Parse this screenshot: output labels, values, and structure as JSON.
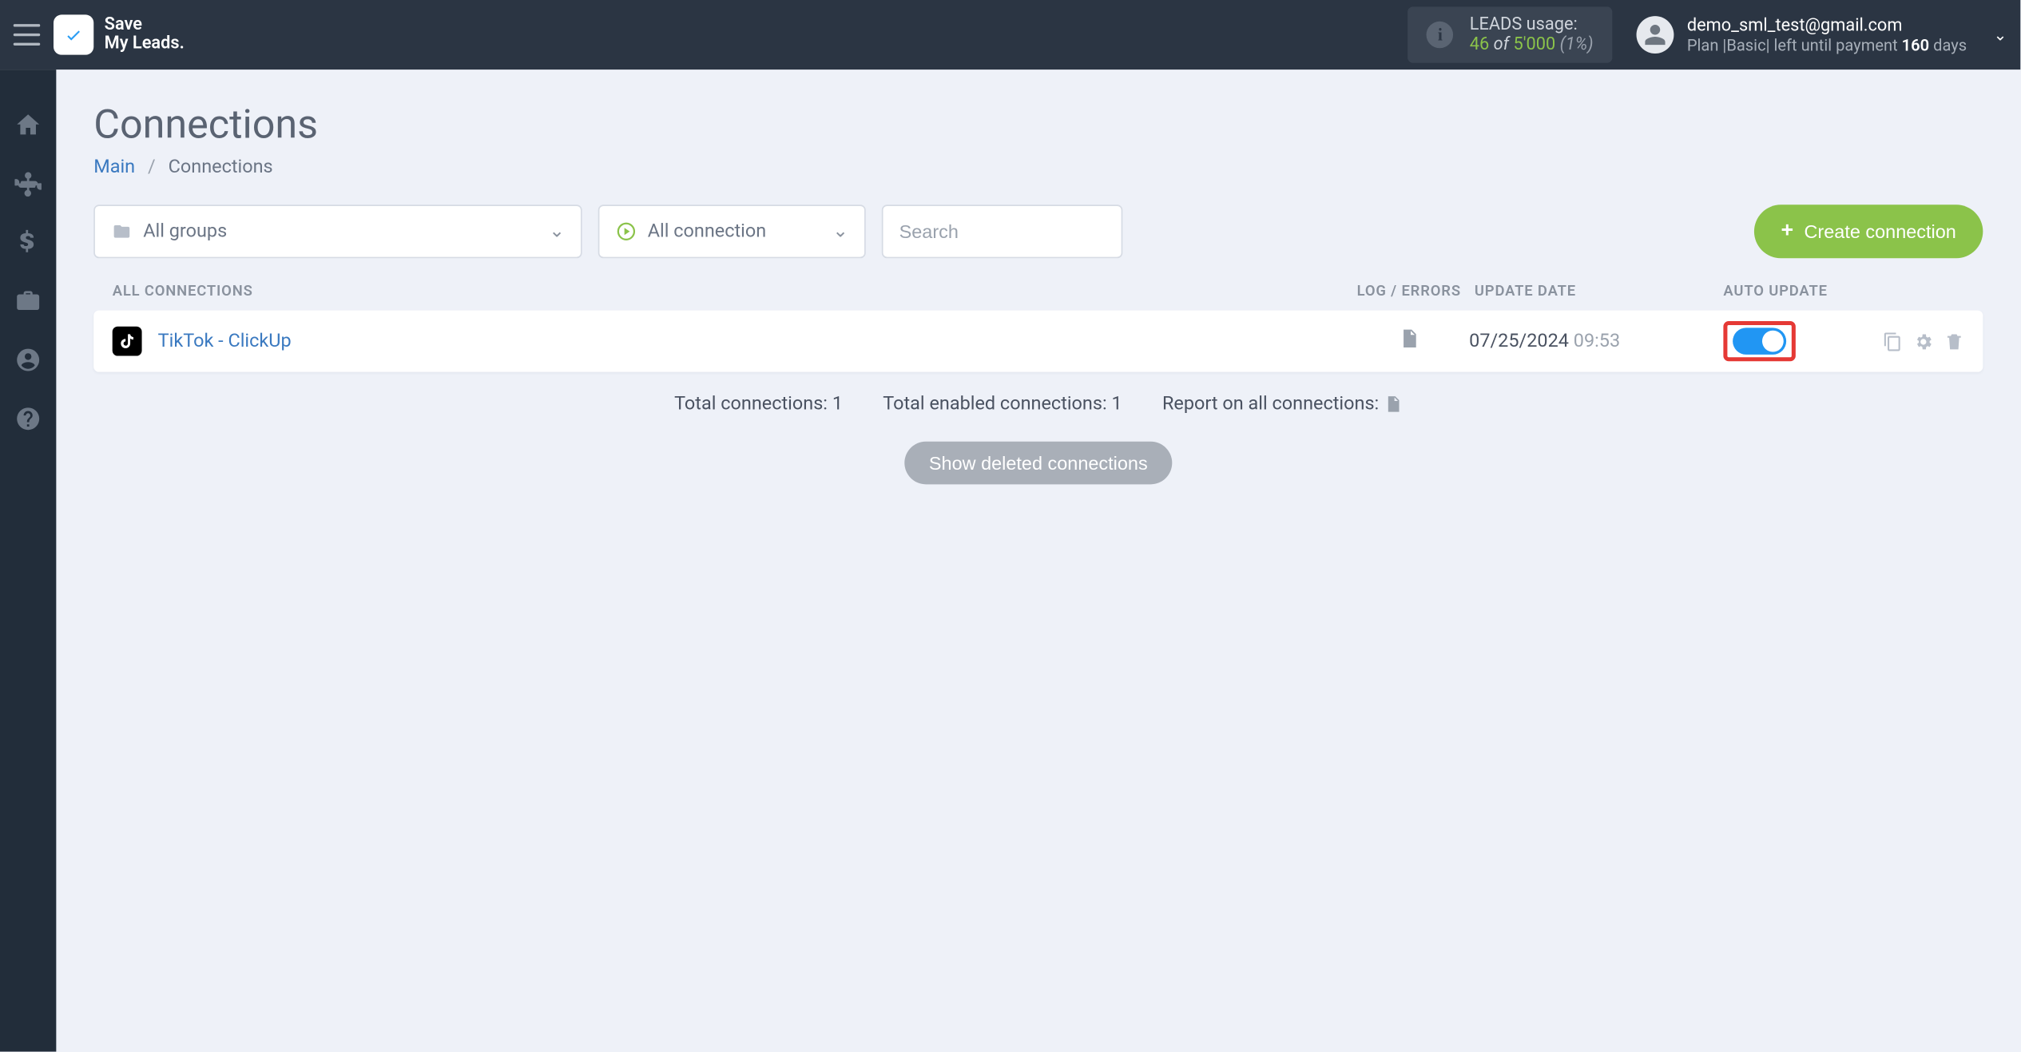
{
  "header": {
    "brand_line1": "Save",
    "brand_line2": "My Leads.",
    "leads_usage_label": "LEADS usage:",
    "leads_used": "46",
    "leads_of": "of",
    "leads_total": "5'000",
    "leads_pct": "(1%)",
    "user_email": "demo_sml_test@gmail.com",
    "plan_prefix": "Plan |",
    "plan_name": "Basic",
    "plan_mid": "| left until payment",
    "plan_days": "160",
    "plan_suffix": "days"
  },
  "page": {
    "title": "Connections",
    "breadcrumb_main": "Main",
    "breadcrumb_current": "Connections"
  },
  "filters": {
    "groups_label": "All groups",
    "status_label": "All connection",
    "search_placeholder": "Search",
    "create_label": "Create connection"
  },
  "table": {
    "head_all": "ALL CONNECTIONS",
    "head_log": "LOG / ERRORS",
    "head_date": "UPDATE DATE",
    "head_auto": "AUTO UPDATE",
    "rows": [
      {
        "name": "TikTok - ClickUp",
        "date": "07/25/2024",
        "time": "09:53",
        "auto_update": true
      }
    ]
  },
  "summary": {
    "total_label": "Total connections:",
    "total_value": "1",
    "enabled_label": "Total enabled connections:",
    "enabled_value": "1",
    "report_label": "Report on all connections:"
  },
  "show_deleted": "Show deleted connections"
}
